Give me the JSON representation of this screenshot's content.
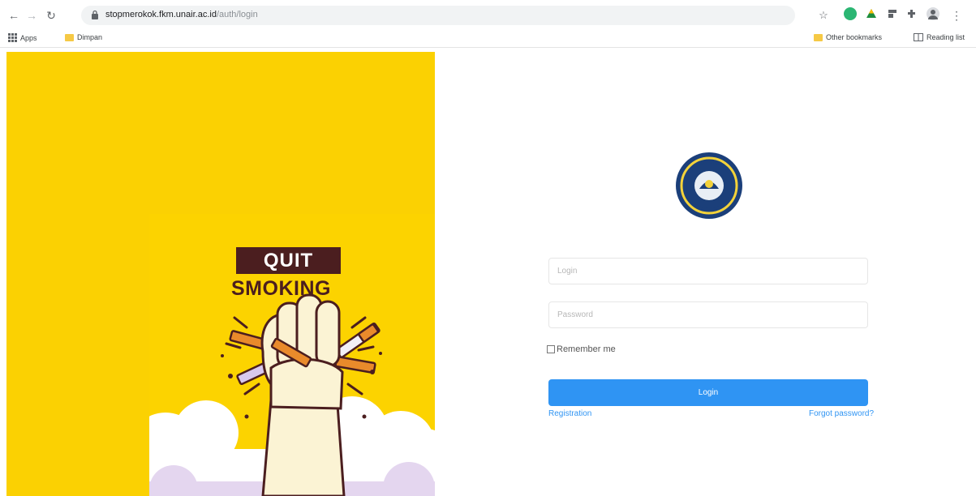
{
  "browser": {
    "url_host": "stopmerokok.fkm.unair.ac.id",
    "url_path": "/auth/login"
  },
  "bookmarks": {
    "apps_label": "Apps",
    "folder_label": "Dimpan",
    "other_label": "Other bookmarks",
    "reading_label": "Reading list"
  },
  "hero": {
    "line1": "QUIT",
    "line2": "SMOKING"
  },
  "form": {
    "login_placeholder": "Login",
    "password_placeholder": "Password",
    "remember_label": "Remember me",
    "submit_label": "Login",
    "registration_link": "Registration",
    "forgot_link": "Forgot password?"
  },
  "colors": {
    "panel": "#fbd102",
    "accent": "#2f94f3",
    "brand_dark": "#4b1e1f"
  },
  "icons": [
    "back-icon",
    "forward-icon",
    "reload-icon",
    "lock-icon",
    "star-icon",
    "extension-icon",
    "profile-icon",
    "menu-icon",
    "apps-grid-icon",
    "folder-icon",
    "reading-list-icon"
  ]
}
